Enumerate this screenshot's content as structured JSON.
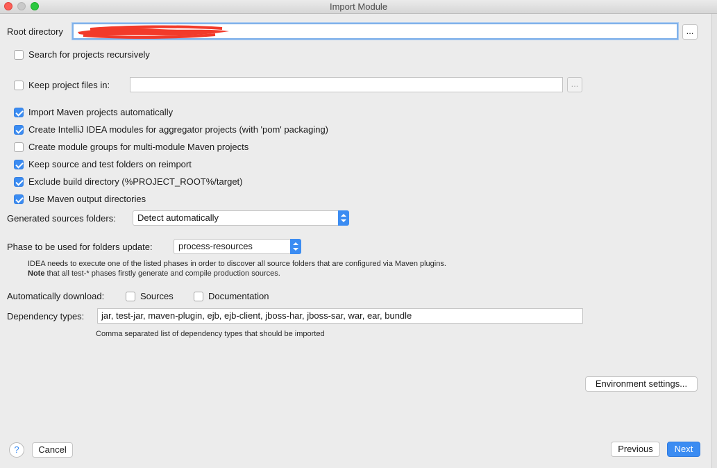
{
  "window": {
    "title": "Import Module"
  },
  "root_directory": {
    "label": "Root directory",
    "value": "",
    "browse_label": "..."
  },
  "search_recursively": {
    "label": "Search for projects recursively",
    "checked": false
  },
  "keep_project_files": {
    "label": "Keep project files in:",
    "checked": false,
    "value": "",
    "browse_label": "..."
  },
  "options": [
    {
      "label": "Import Maven projects automatically",
      "checked": true
    },
    {
      "label": "Create IntelliJ IDEA modules for aggregator projects (with 'pom' packaging)",
      "checked": true
    },
    {
      "label": "Create module groups for multi-module Maven projects",
      "checked": false
    },
    {
      "label": "Keep source and test folders on reimport",
      "checked": true
    },
    {
      "label": "Exclude build directory (%PROJECT_ROOT%/target)",
      "checked": true
    },
    {
      "label": "Use Maven output directories",
      "checked": true
    }
  ],
  "generated_sources": {
    "label": "Generated sources folders:",
    "value": "Detect automatically"
  },
  "phase": {
    "label": "Phase to be used for folders update:",
    "value": "process-resources",
    "help_line1": "IDEA needs to execute one of the listed phases in order to discover all source folders that are configured via Maven plugins.",
    "help_note": "Note",
    "help_line2": " that all test-* phases firstly generate and compile production sources."
  },
  "auto_download": {
    "label": "Automatically download:",
    "sources": {
      "label": "Sources",
      "checked": false
    },
    "documentation": {
      "label": "Documentation",
      "checked": false
    }
  },
  "dependency_types": {
    "label": "Dependency types:",
    "value": "jar, test-jar, maven-plugin, ejb, ejb-client, jboss-har, jboss-sar, war, ear, bundle",
    "hint": "Comma separated list of dependency types that should be imported"
  },
  "buttons": {
    "environment_settings": "Environment settings...",
    "help": "?",
    "cancel": "Cancel",
    "previous": "Previous",
    "next": "Next"
  },
  "colors": {
    "accent": "#3b8cf2",
    "background": "#ececec",
    "redaction": "#f23a2a"
  }
}
